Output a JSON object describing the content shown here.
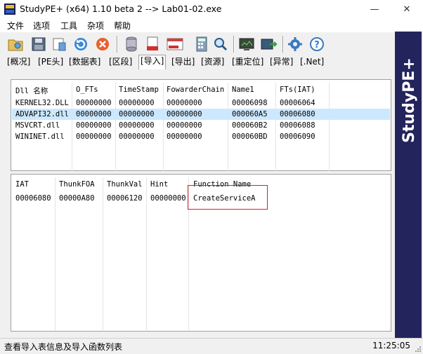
{
  "window": {
    "title": "StudyPE+ (x64) 1.10 beta 2  --> Lab01-02.exe",
    "minimize": "—",
    "close": "✕"
  },
  "menu": [
    "文件",
    "选项",
    "工具",
    "杂项",
    "帮助"
  ],
  "toolbar_icons": [
    "open-folder",
    "save",
    "checksum",
    "refresh",
    "stop",
    "database",
    "asm",
    "asm-file",
    "calculator",
    "search",
    "screen",
    "export",
    "settings",
    "help"
  ],
  "tabs": [
    "[概况]",
    "[PE头]",
    "[数据表]",
    "[区段]",
    "[导入]",
    "[导出]",
    "[资源]",
    "[重定位]",
    "[异常]",
    "[.Net]"
  ],
  "active_tab": 4,
  "dll_table": {
    "headers": [
      "Dll 名称",
      "O_FTs",
      "TimeStamp",
      "FowarderChain",
      "Name1",
      "FTs(IAT)"
    ],
    "rows": [
      [
        "KERNEL32.DLL",
        "00000000",
        "00000000",
        "00000000",
        "00006098",
        "00006064"
      ],
      [
        "ADVAPI32.dll",
        "00000000",
        "00000000",
        "00000000",
        "000060A5",
        "00006080"
      ],
      [
        "MSVCRT.dll",
        "00000000",
        "00000000",
        "00000000",
        "000060B2",
        "00006088"
      ],
      [
        "WININET.dll",
        "00000000",
        "00000000",
        "00000000",
        "000060BD",
        "00006090"
      ]
    ],
    "selected_row": 1
  },
  "func_table": {
    "headers": [
      "IAT",
      "ThunkFOA",
      "ThunkVal",
      "Hint",
      "Function Name"
    ],
    "rows": [
      [
        "00006080",
        "00000A80",
        "00006120",
        "00000000",
        "CreateServiceA"
      ]
    ]
  },
  "sidebar_brand": "StudyPE+",
  "status": {
    "message": "查看导入表信息及导入函数列表",
    "time": "11:25:05"
  },
  "colors": {
    "selection": "#cce8ff",
    "sidebar": "#24245c",
    "highlight": "#e01b24"
  }
}
